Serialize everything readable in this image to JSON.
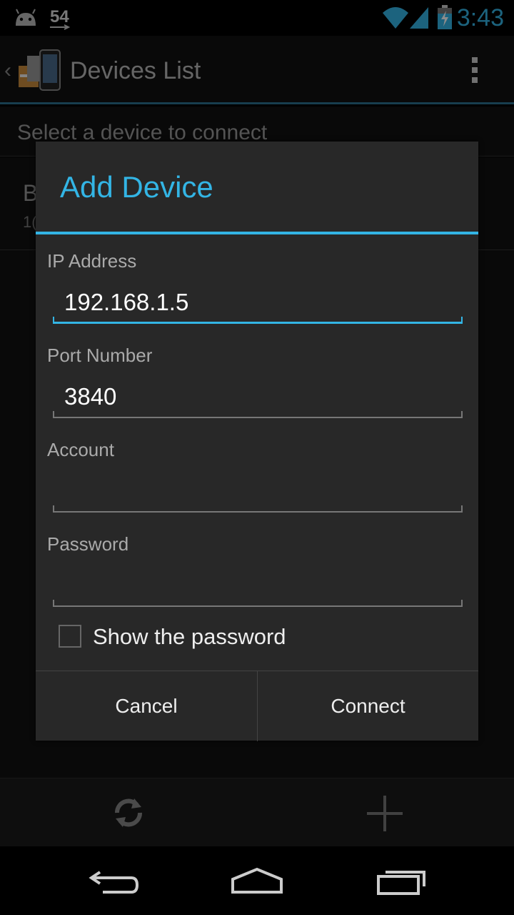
{
  "status_bar": {
    "notification_count": "54",
    "time": "3:43",
    "icons": [
      "android-icon",
      "usb-icon",
      "wifi-icon",
      "signal-icon",
      "battery-charging-icon"
    ]
  },
  "action_bar": {
    "title": "Devices List",
    "icons": [
      "up-caret-icon",
      "app-logo-icon",
      "overflow-menu-icon"
    ]
  },
  "list": {
    "subheader": "Select a device to connect",
    "items": [
      {
        "name": "B",
        "detail": "1("
      }
    ]
  },
  "dialog": {
    "title": "Add Device",
    "fields": {
      "ip_label": "IP Address",
      "ip_value": "192.168.1.5",
      "port_label": "Port Number",
      "port_value": "3840",
      "account_label": "Account",
      "account_value": "",
      "password_label": "Password",
      "password_value": ""
    },
    "show_password_label": "Show the password",
    "show_password_checked": false,
    "cancel_label": "Cancel",
    "connect_label": "Connect"
  },
  "bottom_bar": {
    "icons": [
      "refresh-icon",
      "add-icon"
    ]
  },
  "nav_bar": {
    "icons": [
      "back-icon",
      "home-icon",
      "recent-apps-icon"
    ]
  },
  "colors": {
    "accent": "#33b5e5",
    "dialog_bg": "#282828",
    "background": "#111111"
  }
}
